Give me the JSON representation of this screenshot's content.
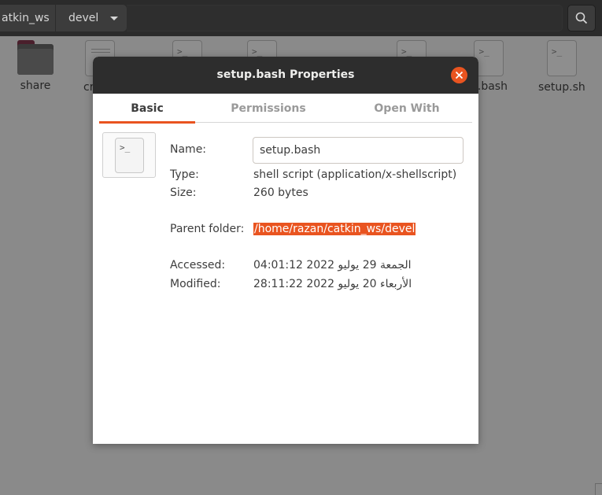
{
  "header": {
    "breadcrumbs": [
      "atkin_ws",
      "devel"
    ]
  },
  "files": [
    {
      "name": "share",
      "type": "folder"
    },
    {
      "name": "cr",
      "type": "doc"
    },
    {
      "name": "",
      "type": "script"
    },
    {
      "name": "",
      "type": "script"
    },
    {
      "name": "",
      "type": "script"
    },
    {
      "name": "p.bash",
      "type": "script",
      "selected": true
    },
    {
      "name": "setup.sh",
      "type": "script"
    }
  ],
  "dialog": {
    "title": "setup.bash Properties",
    "tabs": [
      "Basic",
      "Permissions",
      "Open With"
    ],
    "icon_glyph": ">_",
    "fields": {
      "name_label": "Name:",
      "name_value": "setup.bash",
      "type_label": "Type:",
      "type_value": "shell script (application/x-shellscript)",
      "size_label": "Size:",
      "size_value": "260 bytes",
      "parent_label": "Parent folder:",
      "parent_value": "/home/razan/catkin_ws/devel",
      "accessed_label": "Accessed:",
      "accessed_value": "الجمعة 29 يوليو 2022 04:01:12",
      "modified_label": "Modified:",
      "modified_value": "الأربعاء 20 يوليو 2022 28:11:22"
    }
  },
  "colors": {
    "accent": "#e95420",
    "titlebar": "#2d2d2d",
    "headerbar": "#2b2b2b"
  }
}
